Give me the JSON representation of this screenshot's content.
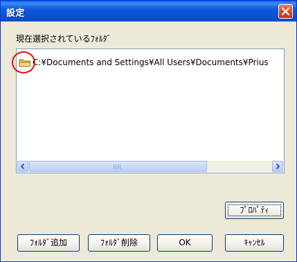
{
  "window": {
    "title": "設定"
  },
  "folder_section": {
    "label": "現在選択されているﾌｫﾙﾀﾞ",
    "items": [
      {
        "path": "C:¥Documents and Settings¥All Users¥Documents¥Prius"
      }
    ]
  },
  "buttons": {
    "properties": "ﾌﾟﾛﾊﾟﾃｨ",
    "add_folder": "ﾌｫﾙﾀﾞ追加",
    "delete_folder": "ﾌｫﾙﾀﾞ削除",
    "ok": "OK",
    "cancel": "ｷｬﾝｾﾙ"
  },
  "colors": {
    "titlebar": "#0a5fe6",
    "dialog_bg": "#ece9d8",
    "highlight_ring": "#e21010"
  },
  "icons": {
    "close": "close-icon",
    "folder": "folder-icon",
    "scroll_left": "chevron-left-icon",
    "scroll_right": "chevron-right-icon"
  }
}
